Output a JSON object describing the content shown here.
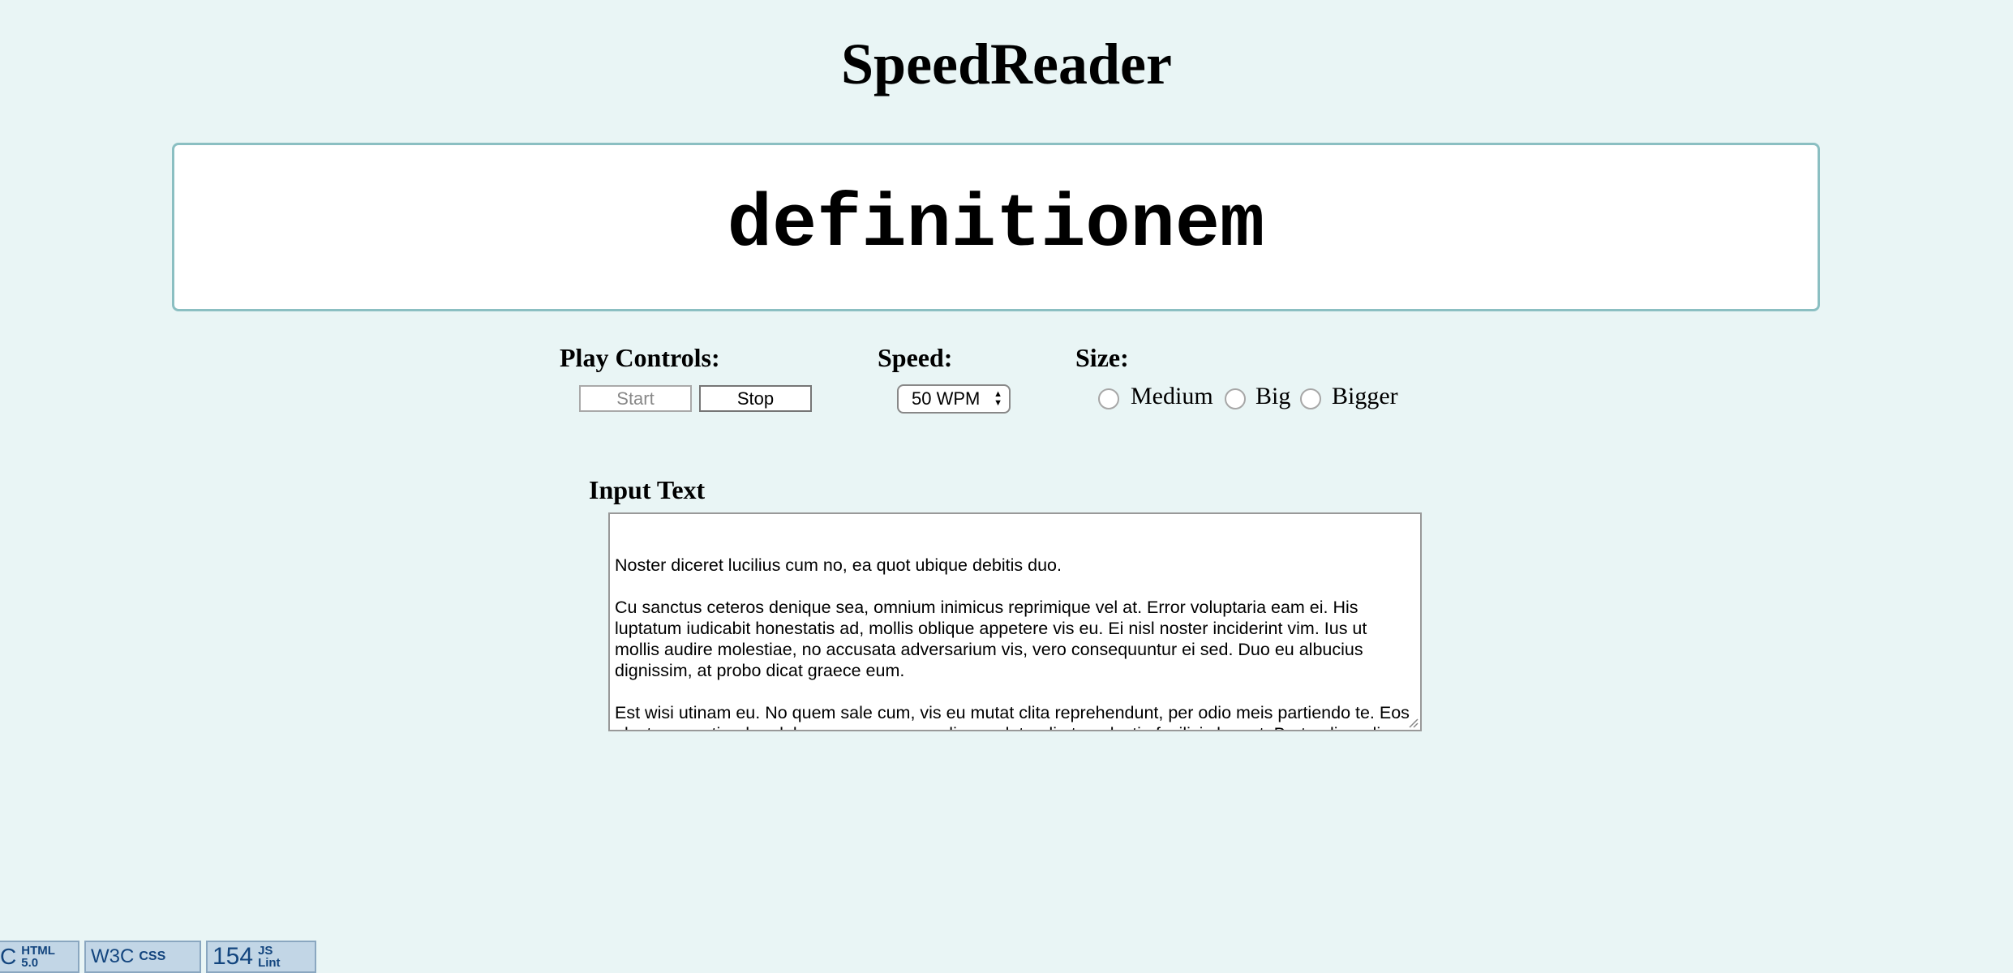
{
  "header": {
    "title": "SpeedReader"
  },
  "display": {
    "current_word": "definitionem"
  },
  "controls": {
    "play_label": "Play Controls:",
    "start_label": "Start",
    "stop_label": "Stop",
    "speed_label": "Speed:",
    "speed_value": "50 WPM",
    "size_label": "Size:",
    "size_options": [
      "Medium",
      "Big",
      "Bigger"
    ]
  },
  "input": {
    "label": "Input Text",
    "text": "Noster diceret lucilius cum no, ea quot ubique debitis duo.\n\nCu sanctus ceteros denique sea, omnium inimicus reprimique vel at. Error voluptaria eam ei. His luptatum iudicabit honestatis ad, mollis oblique appetere vis eu. Ei nisl noster inciderint vim. Ius ut mollis audire molestiae, no accusata adversarium vis, vero consequuntur ei sed. Duo eu albucius dignissim, at probo dicat graece eum.\n\nEst wisi utinam eu. No quem sale cum, vis eu mutat clita reprehendunt, per odio meis partiendo te. Eos electram partiendo adolescens ea, mea meliore salutandi at, molestie facilisis has ut. Brute eligendi intellegebat sed no. Dico zril feugiat no vis."
  },
  "badges": [
    {
      "name": "html5-validator-badge",
      "mark": "C",
      "text": "HTML 5.0"
    },
    {
      "name": "w3c-css-badge",
      "mark": "W3C",
      "text": "CSS"
    },
    {
      "name": "jslint-badge",
      "mark": "154",
      "text": "JS Lint"
    }
  ],
  "colors": {
    "background": "#e9f5f5",
    "word_box_border": "#8bbfc2"
  }
}
